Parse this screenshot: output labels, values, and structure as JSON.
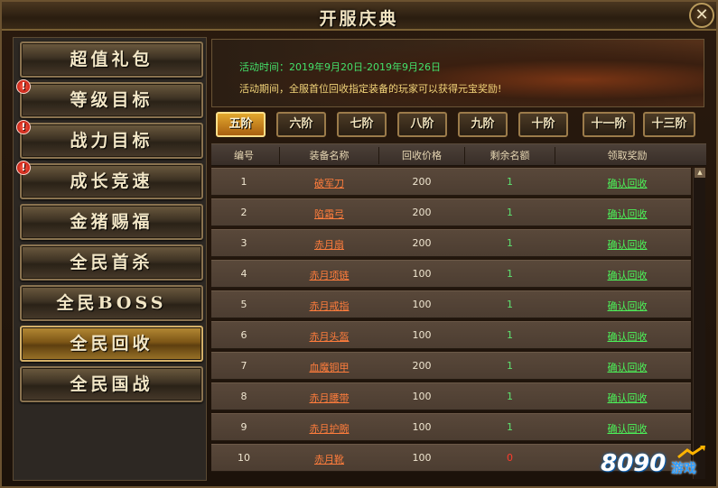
{
  "window": {
    "title": "开服庆典",
    "close": "✕"
  },
  "sidebar": {
    "items": [
      {
        "label": "超值礼包",
        "alert": false,
        "active": false
      },
      {
        "label": "等级目标",
        "alert": true,
        "active": false
      },
      {
        "label": "战力目标",
        "alert": true,
        "active": false
      },
      {
        "label": "成长竞速",
        "alert": true,
        "active": false
      },
      {
        "label": "金猪赐福",
        "alert": false,
        "active": false
      },
      {
        "label": "全民首杀",
        "alert": false,
        "active": false
      },
      {
        "label": "全民BOSS",
        "alert": false,
        "active": false
      },
      {
        "label": "全民回收",
        "alert": false,
        "active": true
      },
      {
        "label": "全民国战",
        "alert": false,
        "active": false
      }
    ],
    "alert_glyph": "!"
  },
  "banner": {
    "time_label": "活动时间：",
    "time_value": "2019年9月20日-2019年9月26日",
    "description": "活动期间，全服首位回收指定装备的玩家可以获得元宝奖励!"
  },
  "tabs": [
    "五阶",
    "六阶",
    "七阶",
    "八阶",
    "九阶",
    "十阶",
    "十一阶",
    "十三阶"
  ],
  "active_tab": "五阶",
  "table": {
    "headers": [
      "编号",
      "装备名称",
      "回收价格",
      "剩余名额",
      "领取奖励"
    ],
    "rows": [
      {
        "no": "1",
        "name": "破军刀",
        "price": "200",
        "remain": "1",
        "claim": "确认回收"
      },
      {
        "no": "2",
        "name": "陷霜弓",
        "price": "200",
        "remain": "1",
        "claim": "确认回收"
      },
      {
        "no": "3",
        "name": "赤月扇",
        "price": "200",
        "remain": "1",
        "claim": "确认回收"
      },
      {
        "no": "4",
        "name": "赤月项链",
        "price": "100",
        "remain": "1",
        "claim": "确认回收"
      },
      {
        "no": "5",
        "name": "赤月戒指",
        "price": "100",
        "remain": "1",
        "claim": "确认回收"
      },
      {
        "no": "6",
        "name": "赤月头盔",
        "price": "100",
        "remain": "1",
        "claim": "确认回收"
      },
      {
        "no": "7",
        "name": "血魔铜甲",
        "price": "200",
        "remain": "1",
        "claim": "确认回收"
      },
      {
        "no": "8",
        "name": "赤月腰带",
        "price": "100",
        "remain": "1",
        "claim": "确认回收"
      },
      {
        "no": "9",
        "name": "赤月护腕",
        "price": "100",
        "remain": "1",
        "claim": "确认回收"
      },
      {
        "no": "10",
        "name": "赤月靴",
        "price": "100",
        "remain": "0",
        "claim": ""
      }
    ]
  },
  "watermark": {
    "number": "8090",
    "text": "游戏"
  },
  "colors": {
    "remain_available": "#5ee36f",
    "remain_empty": "#ff3b2c",
    "equipment_name": "#ff7d3c",
    "claim_link": "#4cf259",
    "active_tab": "#e2a82e"
  }
}
